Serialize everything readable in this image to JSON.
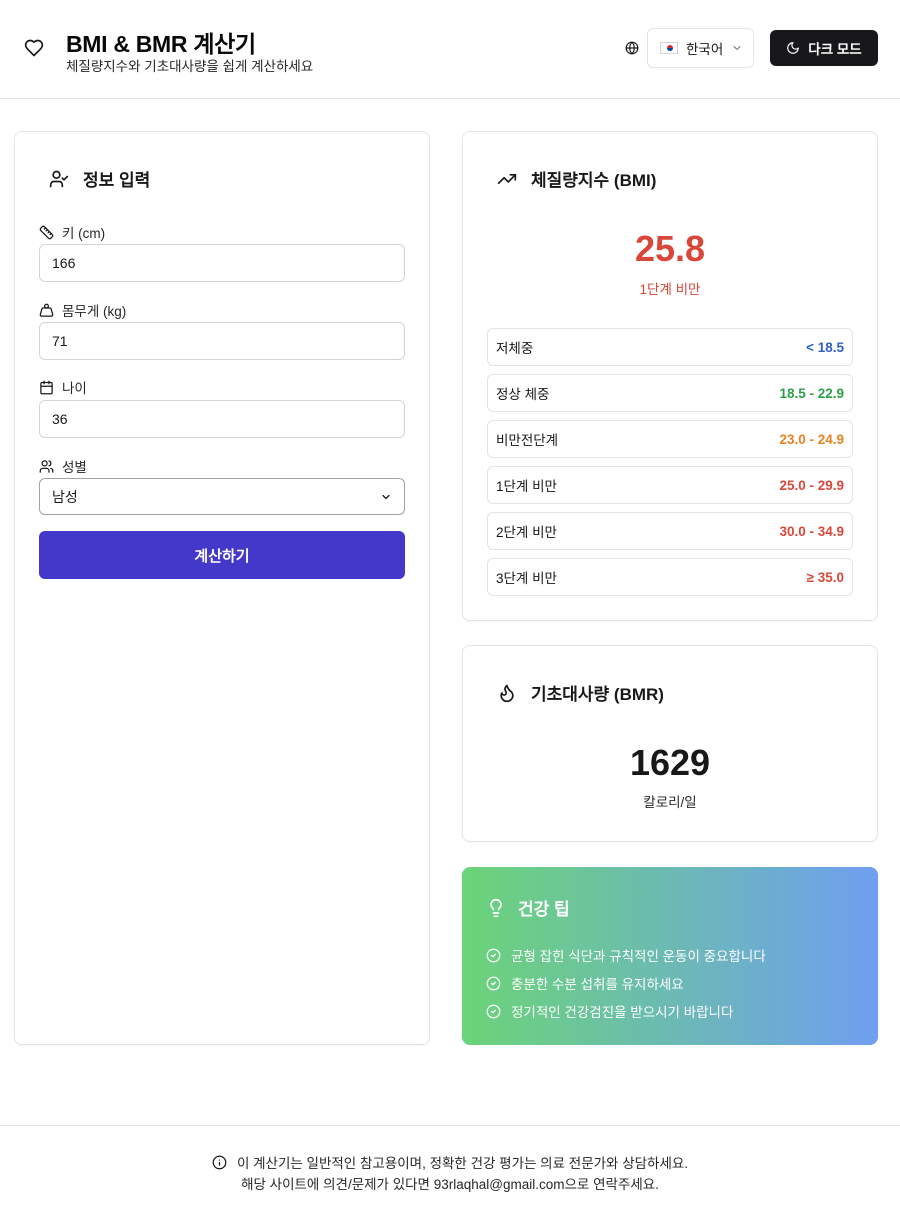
{
  "header": {
    "title": "BMI & BMR 계산기",
    "subtitle": "체질량지수와 기초대사량을 쉽게 계산하세요",
    "language": "한국어",
    "dark_mode_label": "다크 모드"
  },
  "input_card": {
    "title": "정보 입력",
    "fields": {
      "height": {
        "label": "키 (cm)",
        "value": "166"
      },
      "weight": {
        "label": "몸무게 (kg)",
        "value": "71"
      },
      "age": {
        "label": "나이",
        "value": "36"
      },
      "gender": {
        "label": "성별",
        "value": "남성"
      }
    },
    "calculate_label": "계산하기"
  },
  "bmi_card": {
    "title": "체질량지수 (BMI)",
    "value": "25.8",
    "status": "1단계 비만",
    "ranges": [
      {
        "name": "저체중",
        "range": "< 18.5",
        "color": "#2f5fc4"
      },
      {
        "name": "정상 체중",
        "range": "18.5 - 22.9",
        "color": "#2e9e47"
      },
      {
        "name": "비만전단계",
        "range": "23.0 - 24.9",
        "color": "#e8821f"
      },
      {
        "name": "1단계 비만",
        "range": "25.0 - 29.9",
        "color": "#d9473a"
      },
      {
        "name": "2단계 비만",
        "range": "30.0 - 34.9",
        "color": "#d9473a"
      },
      {
        "name": "3단계 비만",
        "range": "≥ 35.0",
        "color": "#d9473a"
      }
    ]
  },
  "bmr_card": {
    "title": "기초대사량 (BMR)",
    "value": "1629",
    "unit": "칼로리/일"
  },
  "tips_card": {
    "title": "건강 팁",
    "tips": [
      "균형 잡힌 식단과 규칙적인 운동이 중요합니다",
      "충분한 수분 섭취를 유지하세요",
      "정기적인 건강검진을 받으시기 바랍니다"
    ]
  },
  "footer": {
    "disclaimer": "이 계산기는 일반적인 참고용이며, 정확한 건강 평가는 의료 전문가와 상담하세요.",
    "contact": "해당 사이트에 의견/문제가 있다면 93rlaqhal@gmail.com으로 연락주세요."
  },
  "colors": {
    "accent": "#4338ca",
    "danger": "#d9473a",
    "tips_gradient_start": "#6bd478",
    "tips_gradient_end": "#6e9ff0"
  }
}
